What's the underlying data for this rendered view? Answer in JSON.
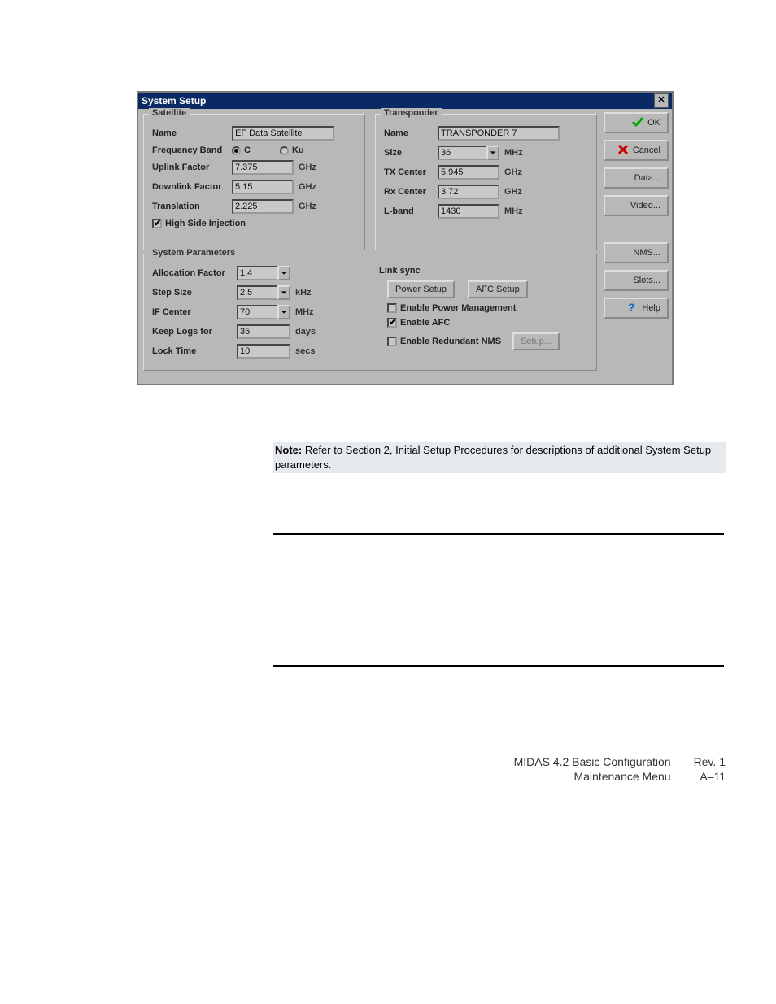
{
  "dialog": {
    "title": "System Setup",
    "close_icon": "close"
  },
  "satellite": {
    "heading": "Satellite",
    "name_label": "Name",
    "name_value": "EF Data Satellite",
    "freq_label": "Frequency Band",
    "radio_c": "C",
    "radio_ku": "Ku",
    "radio_selected": "C",
    "uplink_label": "Uplink Factor",
    "uplink_value": "7.375",
    "uplink_unit": "GHz",
    "downlink_label": "Downlink Factor",
    "downlink_value": "5.15",
    "downlink_unit": "GHz",
    "translation_label": "Translation",
    "translation_value": "2.225",
    "translation_unit": "GHz",
    "hsi_label": "High Side Injection",
    "hsi_checked": true
  },
  "transponder": {
    "heading": "Transponder",
    "name_label": "Name",
    "name_value": "TRANSPONDER 7",
    "size_label": "Size",
    "size_value": "36",
    "size_unit": "MHz",
    "tx_label": "TX Center",
    "tx_value": "5.945",
    "tx_unit": "GHz",
    "rx_label": "Rx Center",
    "rx_value": "3.72",
    "rx_unit": "GHz",
    "lband_label": "L-band",
    "lband_value": "1430",
    "lband_unit": "MHz"
  },
  "sysparams": {
    "heading": "System Parameters",
    "alloc_label": "Allocation Factor",
    "alloc_value": "1.4",
    "step_label": "Step Size",
    "step_value": "2.5",
    "step_unit": "kHz",
    "if_label": "IF Center",
    "if_value": "70",
    "if_unit": "MHz",
    "logs_label": "Keep Logs for",
    "logs_value": "35",
    "logs_unit": "days",
    "lock_label": "Lock Time",
    "lock_value": "10",
    "lock_unit": "secs",
    "link_heading": "Link sync",
    "power_setup": "Power Setup",
    "afc_setup": "AFC Setup",
    "enable_power_label": "Enable Power Management",
    "enable_power_checked": false,
    "enable_afc_label": "Enable AFC",
    "enable_afc_checked": true,
    "enable_redundant_label": "Enable Redundant NMS",
    "enable_redundant_checked": false,
    "setup_btn": "Setup..."
  },
  "side": {
    "ok": "OK",
    "cancel": "Cancel",
    "data": "Data...",
    "video": "Video...",
    "nms": "NMS...",
    "slots": "Slots...",
    "help": "Help"
  },
  "note": {
    "prefix": "Note:",
    "text": " Refer to Section 2, Initial Setup Procedures for descriptions of additional System Setup parameters."
  },
  "footer": {
    "left1": "MIDAS 4.2 Basic Configuration",
    "left2": "Maintenance Menu",
    "right1": "Rev. 1",
    "right2": "A–11"
  }
}
